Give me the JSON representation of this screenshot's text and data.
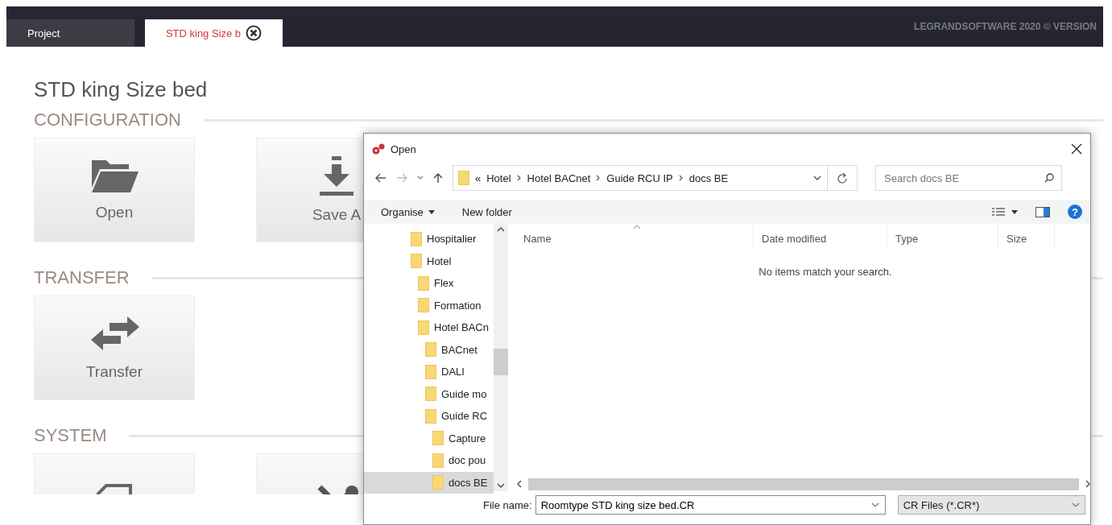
{
  "top_bar": {
    "tabs": [
      {
        "label": "Project",
        "selected": false,
        "closable": false
      },
      {
        "label": "STD king Size b",
        "selected": true,
        "closable": true
      }
    ],
    "copyright": "LEGRANDSOFTWARE 2020 © VERSION"
  },
  "page": {
    "title": "STD king Size bed",
    "sections": [
      {
        "title": "CONFIGURATION",
        "tiles": [
          {
            "kind": "open",
            "label": "Open"
          },
          {
            "kind": "save",
            "label": "Save A"
          }
        ]
      },
      {
        "title": "TRANSFER",
        "tiles": [
          {
            "kind": "transfer",
            "label": "Transfer"
          }
        ]
      },
      {
        "title": "SYSTEM",
        "tiles": [
          {
            "kind": "report"
          },
          {
            "kind": "tools"
          }
        ]
      }
    ]
  },
  "dialog": {
    "title": "Open",
    "address": {
      "overflow": "«",
      "path": [
        "Hotel",
        "Hotel BACnet",
        "Guide RCU IP",
        "docs BE"
      ]
    },
    "search": {
      "placeholder": "Search docs BE"
    },
    "toolbar": {
      "organise": "Organise",
      "new_folder": "New folder",
      "help": "?"
    },
    "tree": [
      {
        "label": "Hospitalier",
        "selected": false
      },
      {
        "label": "Hotel",
        "selected": false,
        "children": [
          {
            "label": "Flex",
            "selected": false
          },
          {
            "label": "Formation",
            "selected": false
          },
          {
            "label": "Hotel BACn",
            "selected": false,
            "children": [
              {
                "label": "BACnet",
                "selected": false
              },
              {
                "label": "DALI",
                "selected": false
              },
              {
                "label": "Guide mo",
                "selected": false
              },
              {
                "label": "Guide RC",
                "selected": false,
                "children": [
                  {
                    "label": "Capture",
                    "selected": false
                  },
                  {
                    "label": "doc pou",
                    "selected": false
                  },
                  {
                    "label": "docs BE",
                    "selected": true
                  }
                ]
              }
            ]
          }
        ]
      }
    ],
    "columns": [
      {
        "label": "Name",
        "sorted": true
      },
      {
        "label": "Date modified",
        "sorted": false
      },
      {
        "label": "Type",
        "sorted": false
      },
      {
        "label": "Size",
        "sorted": false
      }
    ],
    "empty_message": "No items match your search.",
    "file_name": {
      "label": "File name:",
      "value": "Roomtype STD king size bed.CR"
    },
    "file_type": {
      "value": "CR Files (*.CR*)"
    }
  }
}
